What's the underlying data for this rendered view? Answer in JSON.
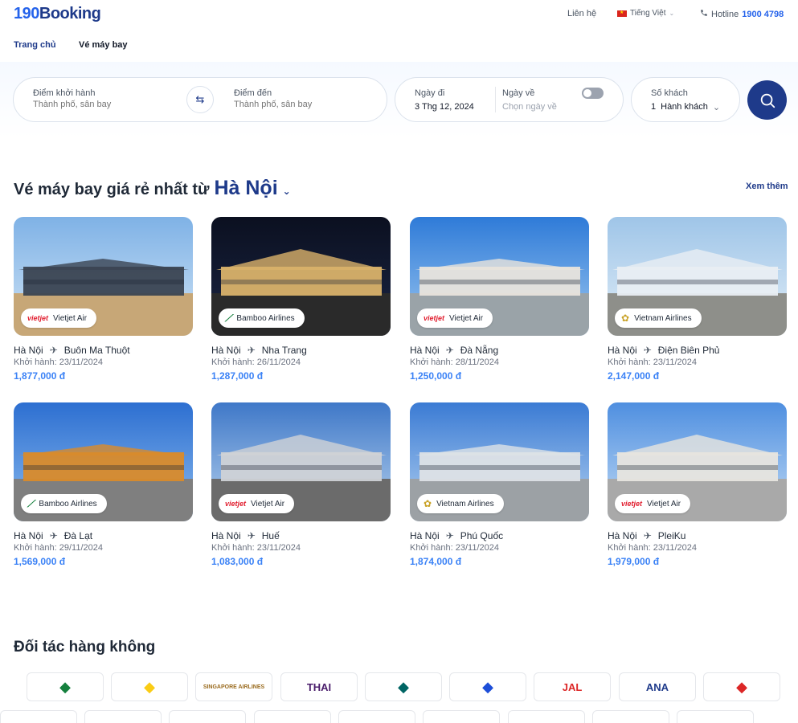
{
  "header": {
    "logo_num": "190",
    "logo_word": "Booking",
    "contact": "Liên hệ",
    "language": "Tiếng Việt",
    "hotline_label": "Hotline",
    "hotline_number": "1900 4798"
  },
  "nav": {
    "home": "Trang chủ",
    "flights": "Vé máy bay"
  },
  "search": {
    "from_label": "Điểm khởi hành",
    "from_placeholder": "Thành phố, sân bay",
    "to_label": "Điểm đến",
    "to_placeholder": "Thành phố, sân bay",
    "depart_label": "Ngày đi",
    "depart_value": "3 Thg 12, 2024",
    "return_label": "Ngày về",
    "return_placeholder": "Chọn ngày về",
    "pax_label": "Số khách",
    "pax_value": "1",
    "pax_unit": "Hành khách"
  },
  "section": {
    "title_prefix": "Vé máy bay giá rẻ nhất từ",
    "city": "Hà Nội",
    "see_more": "Xem thêm"
  },
  "depart_prefix": "Khởi hành:",
  "cards": [
    {
      "from": "Hà Nội",
      "to": "Buôn Ma Thuột",
      "date": "23/11/2024",
      "price": "1,877,000 đ",
      "airline": "Vietjet Air",
      "mark": "vietjet",
      "color": "#e11d2e"
    },
    {
      "from": "Hà Nội",
      "to": "Nha Trang",
      "date": "26/11/2024",
      "price": "1,287,000 đ",
      "airline": "Bamboo Airlines",
      "mark": "bamboo",
      "color": "#15803d"
    },
    {
      "from": "Hà Nội",
      "to": "Đà Nẵng",
      "date": "28/11/2024",
      "price": "1,250,000 đ",
      "airline": "Vietjet Air",
      "mark": "vietjet",
      "color": "#e11d2e"
    },
    {
      "from": "Hà Nội",
      "to": "Điện Biên Phủ",
      "date": "23/11/2024",
      "price": "2,147,000 đ",
      "airline": "Vietnam Airlines",
      "mark": "vna",
      "color": "#c9a227"
    },
    {
      "from": "Hà Nội",
      "to": "Đà Lạt",
      "date": "29/11/2024",
      "price": "1,569,000 đ",
      "airline": "Bamboo Airlines",
      "mark": "bamboo",
      "color": "#15803d"
    },
    {
      "from": "Hà Nội",
      "to": "Huế",
      "date": "23/11/2024",
      "price": "1,083,000 đ",
      "airline": "Vietjet Air",
      "mark": "vietjet",
      "color": "#e11d2e"
    },
    {
      "from": "Hà Nội",
      "to": "Phú Quốc",
      "date": "23/11/2024",
      "price": "1,874,000 đ",
      "airline": "Vietnam Airlines",
      "mark": "vna",
      "color": "#c9a227"
    },
    {
      "from": "Hà Nội",
      "to": "PleiKu",
      "date": "23/11/2024",
      "price": "1,979,000 đ",
      "airline": "Vietjet Air",
      "mark": "vietjet",
      "color": "#e11d2e"
    }
  ],
  "vietjet_logo_text": "vietjet",
  "partners_title": "Đối tác hàng không",
  "partners": [
    {
      "icon": "bamboo-logo-icon",
      "text": "",
      "color": "#15803d"
    },
    {
      "icon": "vietravel-logo-icon",
      "text": "",
      "color": "#facc15"
    },
    {
      "icon": "singapore-airlines-logo-icon",
      "text": "SINGAPORE AIRLINES",
      "color": "#9a6b1e"
    },
    {
      "icon": "thai-airways-logo-icon",
      "text": "THAI",
      "color": "#4a1d6b"
    },
    {
      "icon": "cathay-logo-icon",
      "text": "",
      "color": "#006564"
    },
    {
      "icon": "korean-air-logo-icon",
      "text": "",
      "color": "#1d4ed8"
    },
    {
      "icon": "jal-logo-icon",
      "text": "JAL",
      "color": "#dc2626"
    },
    {
      "icon": "ana-logo-icon",
      "text": "ANA",
      "color": "#1e3a8a"
    },
    {
      "icon": "malaysia-airlines-logo-icon",
      "text": "",
      "color": "#dc2626"
    }
  ]
}
